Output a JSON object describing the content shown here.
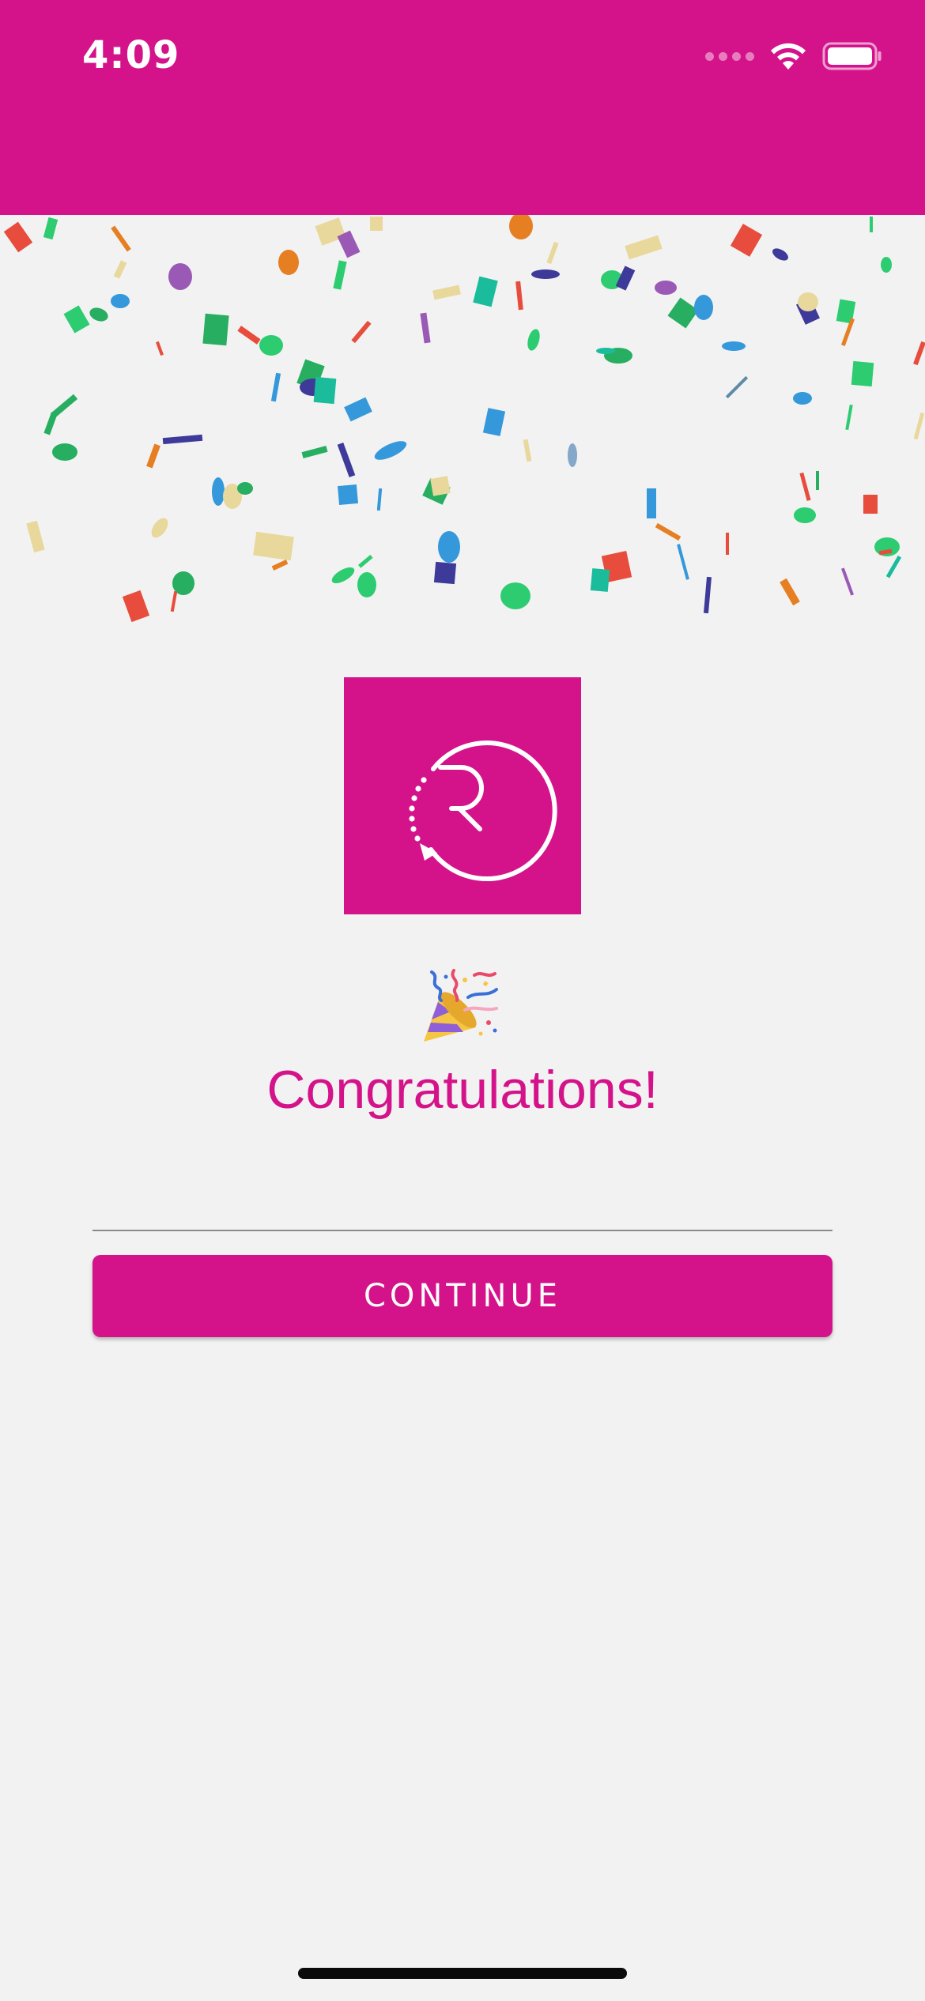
{
  "status_bar": {
    "time": "4:09"
  },
  "congrats": {
    "title": "Congratulations!",
    "emoji": "party-popper"
  },
  "actions": {
    "continue_label": "CONTINUE"
  },
  "colors": {
    "brand": "#d4138b",
    "background": "#f2f2f2"
  },
  "icons": {
    "logo": "r-circle-logo-icon",
    "wifi": "wifi-icon",
    "battery": "battery-icon"
  }
}
